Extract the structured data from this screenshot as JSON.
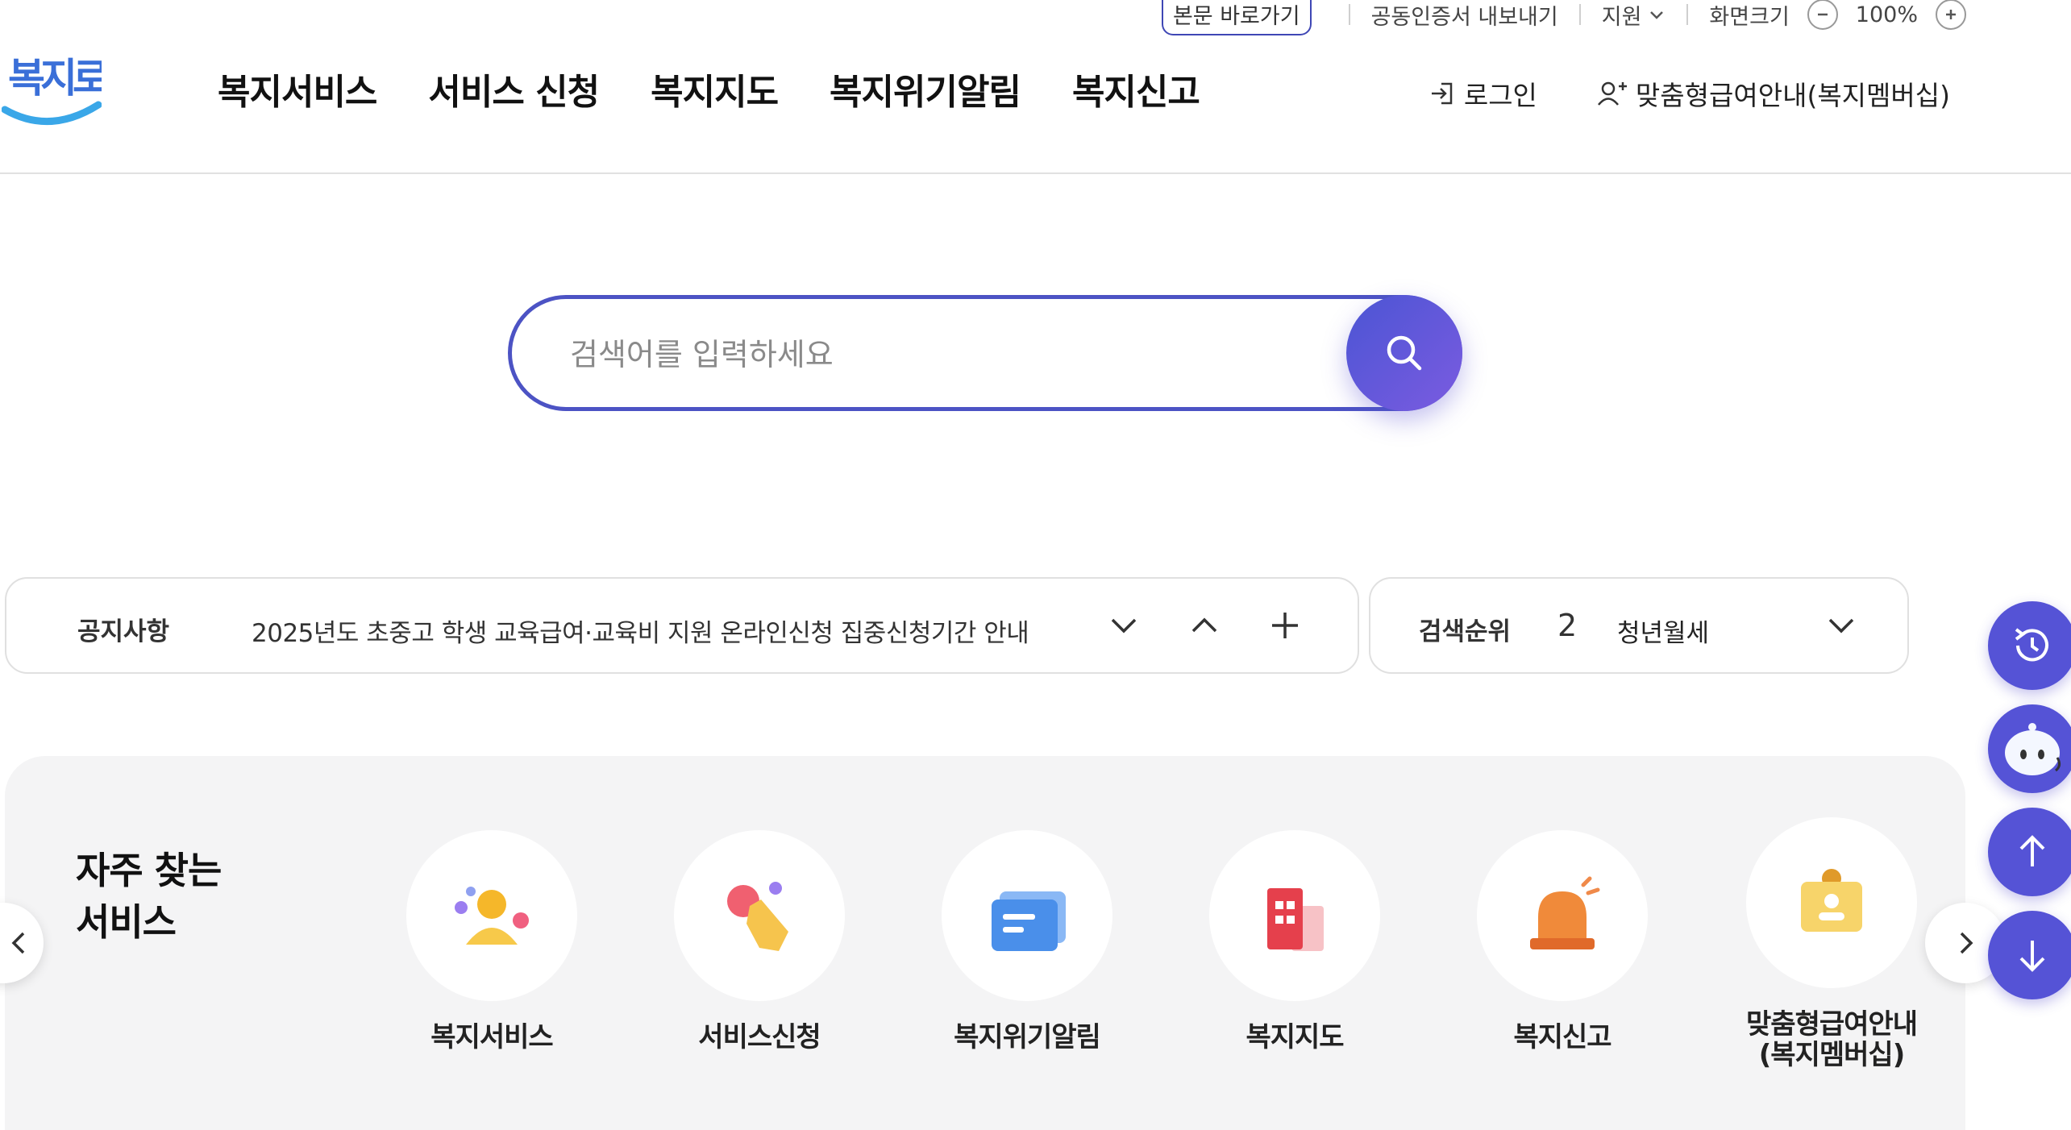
{
  "utility": {
    "skip_link": "본문 바로가기",
    "cert_export": "공동인증서 내보내기",
    "support": "지원",
    "zoom_label": "화면크기",
    "zoom_value": "100%"
  },
  "header": {
    "logo_text": "복지로",
    "nav": [
      "복지서비스",
      "서비스 신청",
      "복지지도",
      "복지위기알림",
      "복지신고"
    ],
    "login": "로그인",
    "membership": "맞춤형급여안내(복지멤버십)"
  },
  "search": {
    "placeholder": "검색어를 입력하세요"
  },
  "notice": {
    "label": "공지사항",
    "text": "2025년도 초중고 학생 교육급여·교육비 지원 온라인신청 집중신청기간 안내"
  },
  "ranking": {
    "label": "검색순위",
    "number": "2",
    "keyword": "청년월세"
  },
  "frequent": {
    "title_line1": "자주 찾는",
    "title_line2": "서비스",
    "items": [
      {
        "label": "복지서비스",
        "icon": "person-icon"
      },
      {
        "label": "서비스신청",
        "icon": "hand-tap-icon"
      },
      {
        "label": "복지위기알림",
        "icon": "message-card-icon"
      },
      {
        "label": "복지지도",
        "icon": "building-map-icon"
      },
      {
        "label": "복지신고",
        "icon": "siren-icon"
      },
      {
        "label": "맞춤형급여안내\n(복지멤버십)",
        "icon": "id-card-icon"
      }
    ]
  },
  "colors": {
    "accent": "#4c53c4",
    "accent_gradient_end": "#7b5be0",
    "floating": "#5553d6",
    "panel_bg": "#f4f4f5"
  }
}
